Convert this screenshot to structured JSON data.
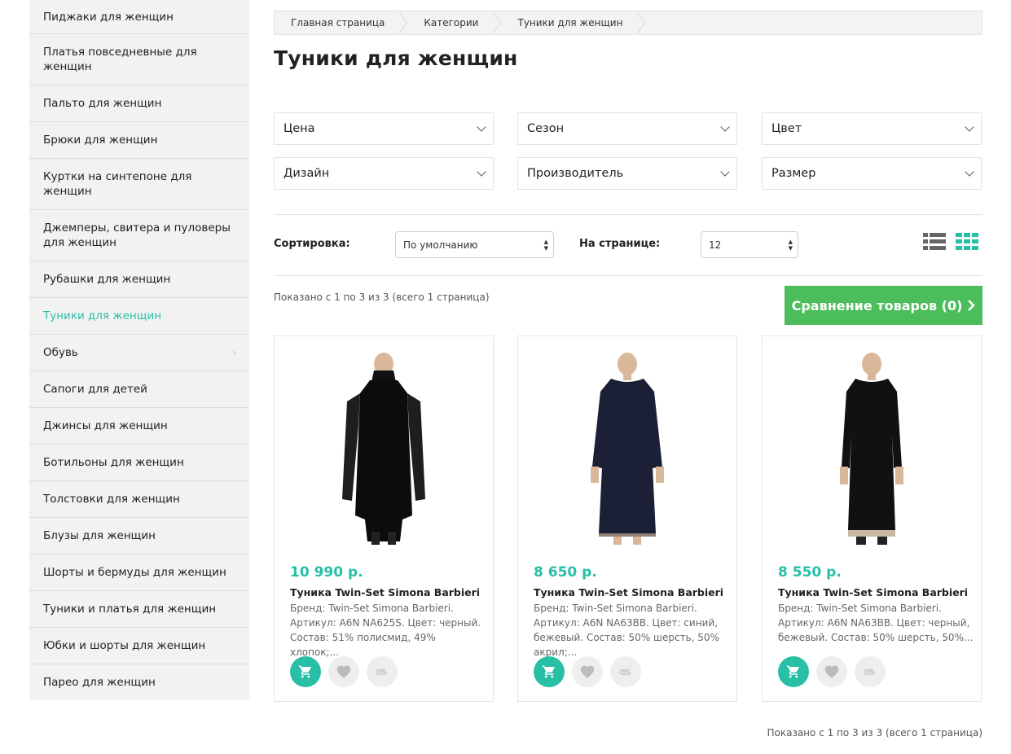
{
  "sidebar": {
    "items": [
      {
        "label": "Пиджаки для женщин"
      },
      {
        "label": "Платья повседневные для женщин"
      },
      {
        "label": "Пальто для женщин"
      },
      {
        "label": "Брюки для женщин"
      },
      {
        "label": "Куртки на синтепоне для женщин"
      },
      {
        "label": "Джемперы, свитера и пуловеры для женщин"
      },
      {
        "label": "Рубашки для женщин"
      },
      {
        "label": "Туники для женщин"
      },
      {
        "label": "Обувь"
      },
      {
        "label": "Сапоги для детей"
      },
      {
        "label": "Джинсы для женщин"
      },
      {
        "label": "Ботильоны для женщин"
      },
      {
        "label": "Толстовки для женщин"
      },
      {
        "label": "Блузы для женщин"
      },
      {
        "label": "Шорты и бермуды для женщин"
      },
      {
        "label": "Туники и платья для женщин"
      },
      {
        "label": "Юбки и шорты для женщин"
      },
      {
        "label": "Парео для женщин"
      }
    ]
  },
  "breadcrumb": [
    "Главная страница",
    "Категории",
    "Туники для женщин"
  ],
  "page": {
    "title": "Туники для женщин"
  },
  "filters": [
    "Цена",
    "Сезон",
    "Цвет",
    "Дизайн",
    "Производитель",
    "Размер"
  ],
  "toolbar": {
    "sort_label": "Сортировка:",
    "sort_value": "По умолчанию",
    "per_page_label": "На странице:",
    "per_page_value": "12"
  },
  "pagination": {
    "shown_text": "Показано с 1 по 3 из 3 (всего 1 страница)"
  },
  "compare": {
    "label": "Сравнение товаров (0)"
  },
  "products": [
    {
      "price": "10 990 р.",
      "name": "Туника Twin-Set Simona Barbieri",
      "desc": "Бренд: Twin-Set Simona Barbieri. Артикул: A6N NA625S. Цвет: черный. Состав: 51% полисмид, 49% хлопок;..."
    },
    {
      "price": "8 650 р.",
      "name": "Туника Twin-Set Simona Barbieri",
      "desc": "Бренд: Twin-Set Simona Barbieri. Артикул: A6N NA63BB. Цвет: синий, бежевый. Состав: 50% шерсть, 50% акрил;..."
    },
    {
      "price": "8 550 р.",
      "name": "Туника Twin-Set Simona Barbieri",
      "desc": "Бренд: Twin-Set Simona Barbieri. Артикул: A6N NA63BB. Цвет: черный, бежевый. Состав: 50% шерсть, 50%..."
    }
  ],
  "colors": {
    "accent": "#27bfa6",
    "compare_green": "#4bbd5a"
  },
  "icons": {
    "cart": "cart-icon",
    "wishlist": "heart-icon",
    "compare": "paperclip-icon",
    "list_view": "list-view-icon",
    "grid_view": "grid-view-icon"
  }
}
